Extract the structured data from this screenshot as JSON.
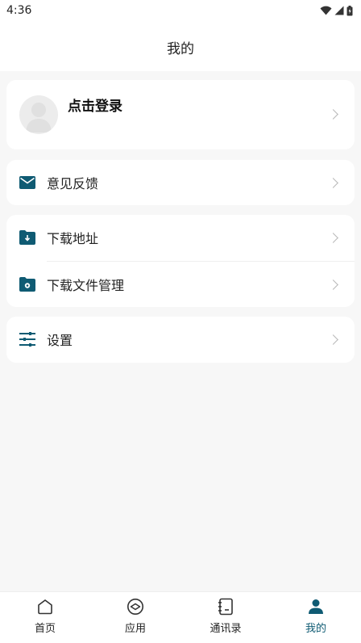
{
  "status_bar": {
    "time": "4:36"
  },
  "app_bar": {
    "title": "我的"
  },
  "profile": {
    "login_label": "点击登录"
  },
  "menu": {
    "feedback": "意见反馈",
    "download_address": "下载地址",
    "download_file_manage": "下载文件管理",
    "settings": "设置"
  },
  "bottom_nav": [
    {
      "label": "首页",
      "icon": "home-icon",
      "active": false
    },
    {
      "label": "应用",
      "icon": "apps-icon",
      "active": false
    },
    {
      "label": "通讯录",
      "icon": "contacts-icon",
      "active": false
    },
    {
      "label": "我的",
      "icon": "user-icon",
      "active": true
    }
  ],
  "colors": {
    "accent": "#0f5b73",
    "background": "#f7f7f7",
    "card": "#ffffff"
  }
}
